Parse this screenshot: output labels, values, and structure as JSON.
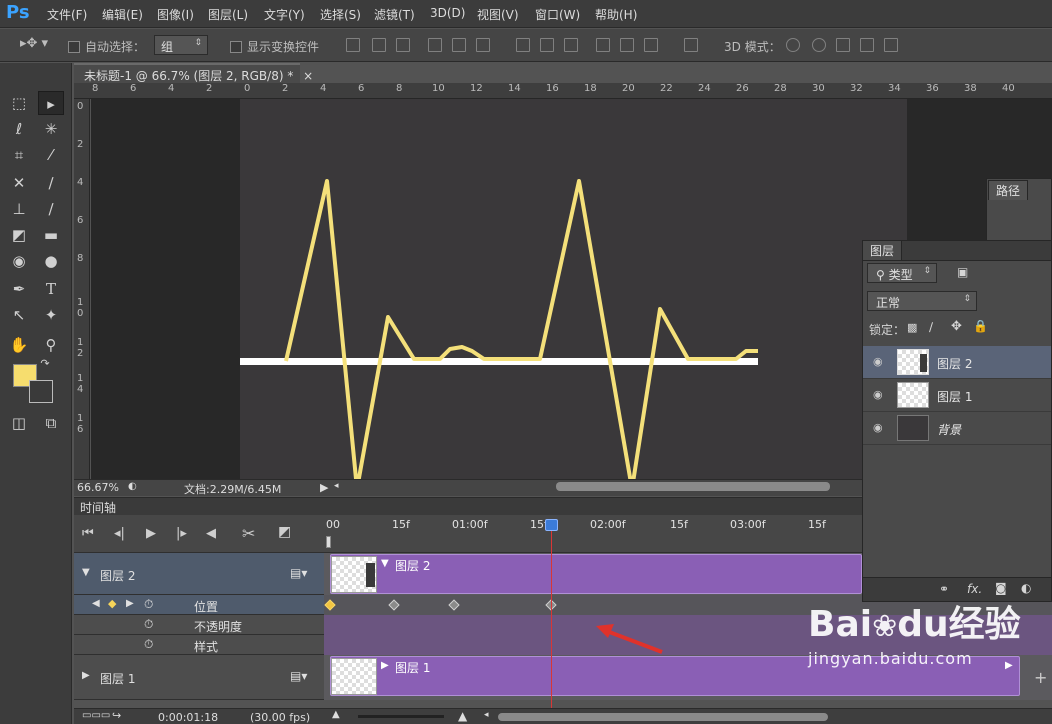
{
  "app": {
    "logo": "Ps"
  },
  "menu": [
    "文件(F)",
    "编辑(E)",
    "图像(I)",
    "图层(L)",
    "文字(Y)",
    "选择(S)",
    "滤镜(T)",
    "3D(D)",
    "视图(V)",
    "窗口(W)",
    "帮助(H)"
  ],
  "options": {
    "auto_select_label": "自动选择：",
    "auto_select_value": "组",
    "transform_label": "显示变换控件",
    "mode3d_label": "3D 模式："
  },
  "document": {
    "tab_title": "未标题-1 @ 66.7% (图层 2, RGB/8) *",
    "close": "×"
  },
  "ruler_top": [
    "8",
    "6",
    "4",
    "2",
    "0",
    "2",
    "4",
    "6",
    "8",
    "10",
    "12",
    "14",
    "16",
    "18",
    "20",
    "22",
    "24",
    "26",
    "28",
    "30",
    "32",
    "34",
    "36",
    "38",
    "40"
  ],
  "ruler_left": [
    "0",
    "2",
    "4",
    "6",
    "8",
    "1\n0",
    "1\n2",
    "1\n4",
    "1\n6"
  ],
  "status": {
    "zoom": "66.67%",
    "doc_info": "文档:2.29M/6.45M"
  },
  "timeline": {
    "tab": "时间轴",
    "ticks": [
      "00",
      "15f",
      "01:00f",
      "15f",
      "02:00f",
      "15f",
      "03:00f",
      "15f"
    ],
    "layers": [
      {
        "name": "图层 2",
        "clip_label": "图层 2",
        "expanded": true
      },
      {
        "name": "图层 1",
        "clip_label": "图层 1",
        "expanded": false
      }
    ],
    "properties": [
      "位置",
      "不透明度",
      "样式"
    ],
    "footer_time": "0:00:01:18",
    "footer_fps": "(30.00 fps)"
  },
  "layers_panel": {
    "tab": "图层",
    "filter_label": "类型",
    "blend_mode": "正常",
    "lock_label": "锁定：",
    "layers": [
      {
        "name": "图层 2",
        "selected": true
      },
      {
        "name": "图层 1",
        "selected": false
      },
      {
        "name": "背景",
        "selected": false
      }
    ],
    "footer_icons": [
      "link-icon",
      "fx-icon",
      "mask-icon",
      "adjustment-icon"
    ],
    "fx_label": "fx."
  },
  "paths_panel": {
    "tab": "路径"
  },
  "watermark": {
    "brand": "Bai",
    "paw": "du",
    "suffix": "经验",
    "url": "jingyan.baidu.com"
  },
  "colors": {
    "foreground": "#f6dd6e",
    "background": "#3a3a3a",
    "accent": "#8a5fb5",
    "playhead": "#d93636",
    "waveform": "#f4e07a"
  }
}
